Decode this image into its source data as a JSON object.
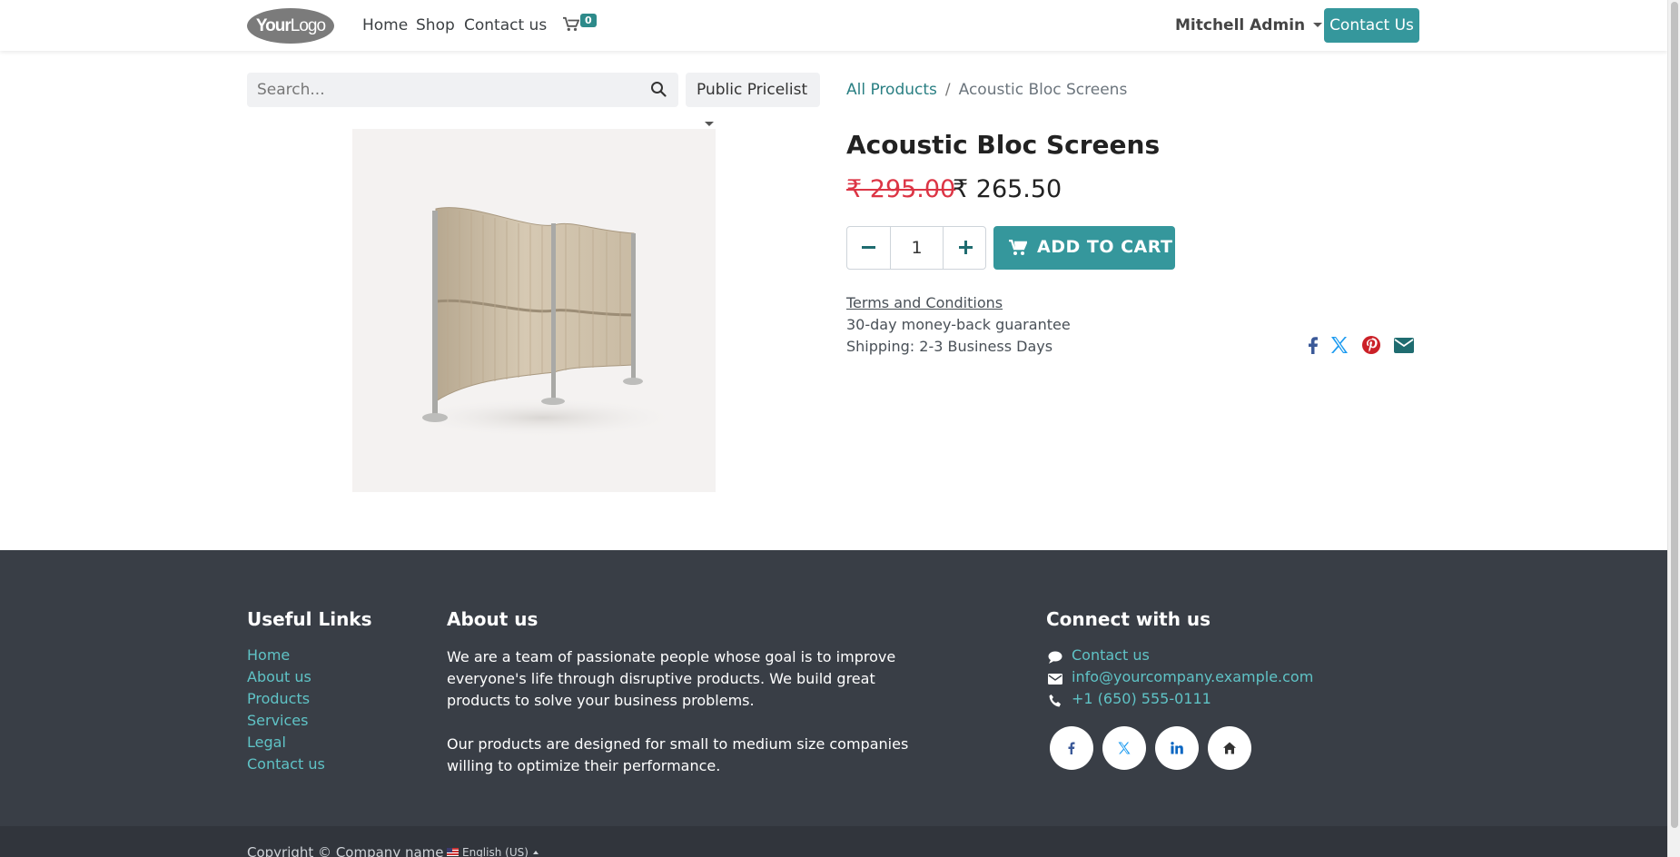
{
  "header": {
    "logo_main": "Your",
    "logo_thin": "Logo",
    "nav": [
      "Home",
      "Shop",
      "Contact us"
    ],
    "cart_count": "0",
    "user": "Mitchell Admin",
    "contact_button": "Contact Us"
  },
  "search": {
    "placeholder": "Search...",
    "pricelist": "Public Pricelist"
  },
  "breadcrumb": {
    "parent": "All Products",
    "current": "Acoustic Bloc Screens"
  },
  "product": {
    "title": "Acoustic Bloc Screens",
    "old_price": "₹ 295.00",
    "new_price": "₹ 265.50",
    "quantity": "1",
    "add_to_cart": "ADD TO CART",
    "terms": "Terms and Conditions",
    "guarantee": "30-day money-back guarantee",
    "shipping": "Shipping: 2-3 Business Days",
    "share_icons": [
      "facebook-icon",
      "x-icon",
      "pinterest-icon",
      "email-icon"
    ]
  },
  "footer": {
    "useful_links_title": "Useful Links",
    "useful_links": [
      "Home",
      "About us",
      "Products",
      "Services",
      "Legal",
      "Contact us"
    ],
    "about_title": "About us",
    "about_p1": "We are a team of passionate people whose goal is to improve everyone's life through disruptive products. We build great products to solve your business problems.",
    "about_p2": "Our products are designed for small to medium size companies willing to optimize their performance.",
    "connect_title": "Connect with us",
    "connect_contact": "Contact us",
    "connect_email": "info@yourcompany.example.com",
    "connect_phone": "+1 (650) 555-0111",
    "social_icons": [
      "facebook-icon",
      "x-icon",
      "linkedin-icon",
      "home-icon"
    ],
    "copyright": "Copyright © Company name",
    "language": "English (US)"
  },
  "colors": {
    "accent": "#35979c",
    "link": "#2a7f83",
    "footer_bg": "#393e46",
    "old_price": "#dc3545"
  }
}
